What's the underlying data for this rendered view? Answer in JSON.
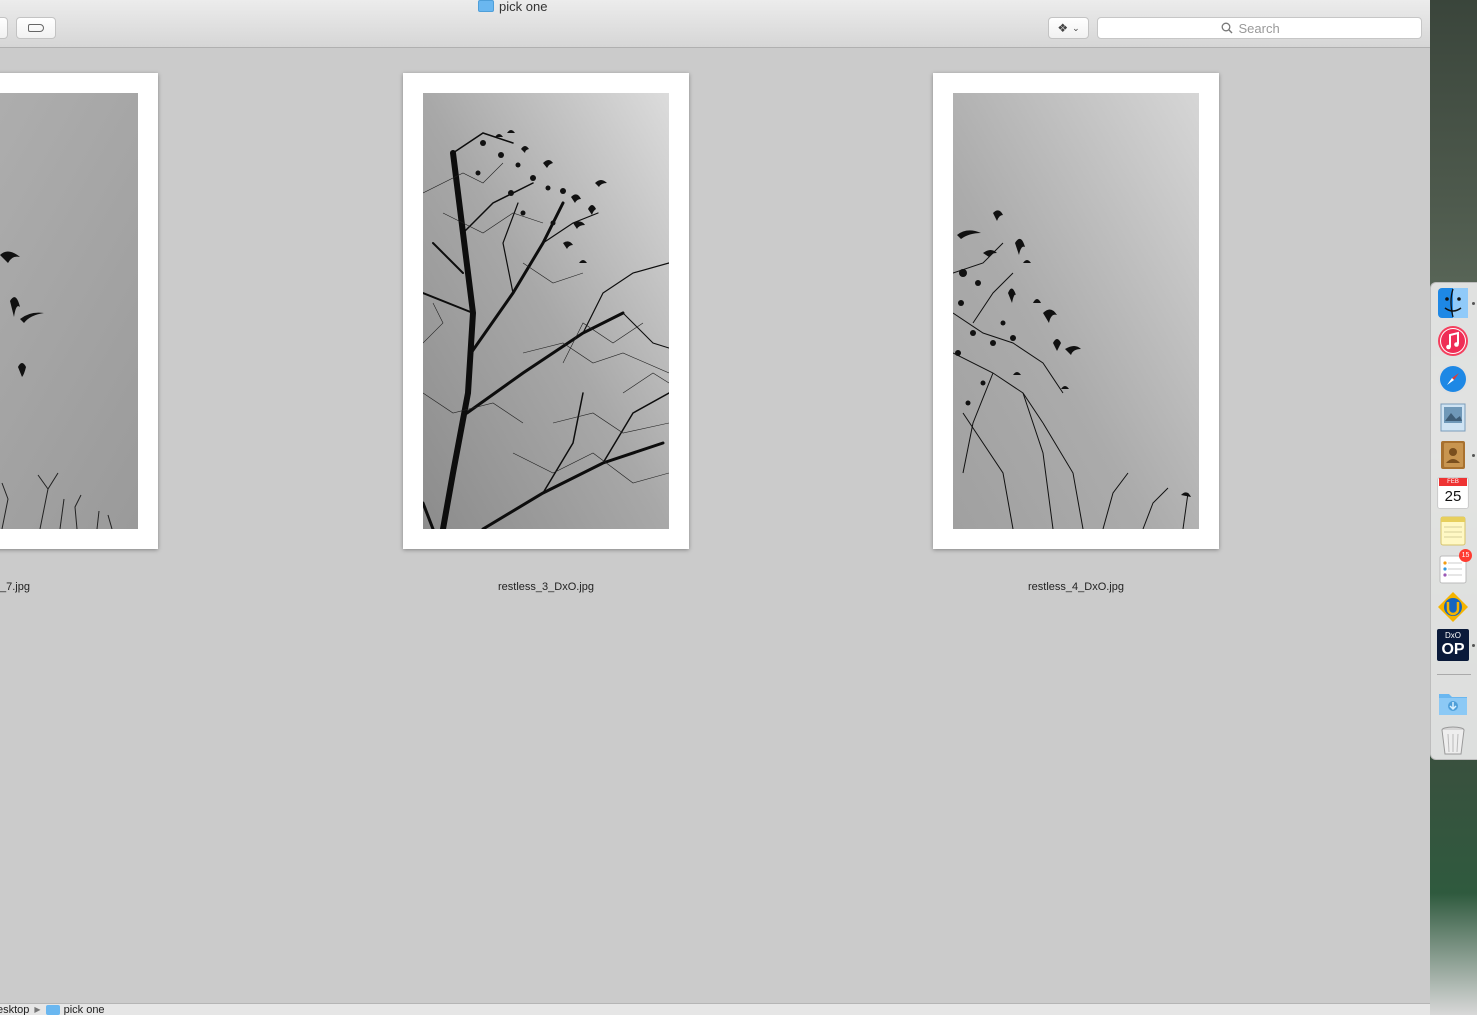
{
  "window": {
    "title": "pick one"
  },
  "toolbar": {
    "search_placeholder": "Search"
  },
  "files": [
    {
      "name": "_7.jpg"
    },
    {
      "name": "restless_3_DxO.jpg"
    },
    {
      "name": "restless_4_DxO.jpg"
    }
  ],
  "pathbar": {
    "segments": [
      "esktop",
      "pick one"
    ]
  },
  "dock": {
    "calendar_month": "FEB",
    "calendar_day": "25",
    "reminders_badge": "15",
    "dxo_top": "DxO",
    "dxo_bottom": "OP"
  },
  "colors": {
    "window_bg": "#cbcbcb",
    "folder_blue": "#6ab7f0"
  }
}
